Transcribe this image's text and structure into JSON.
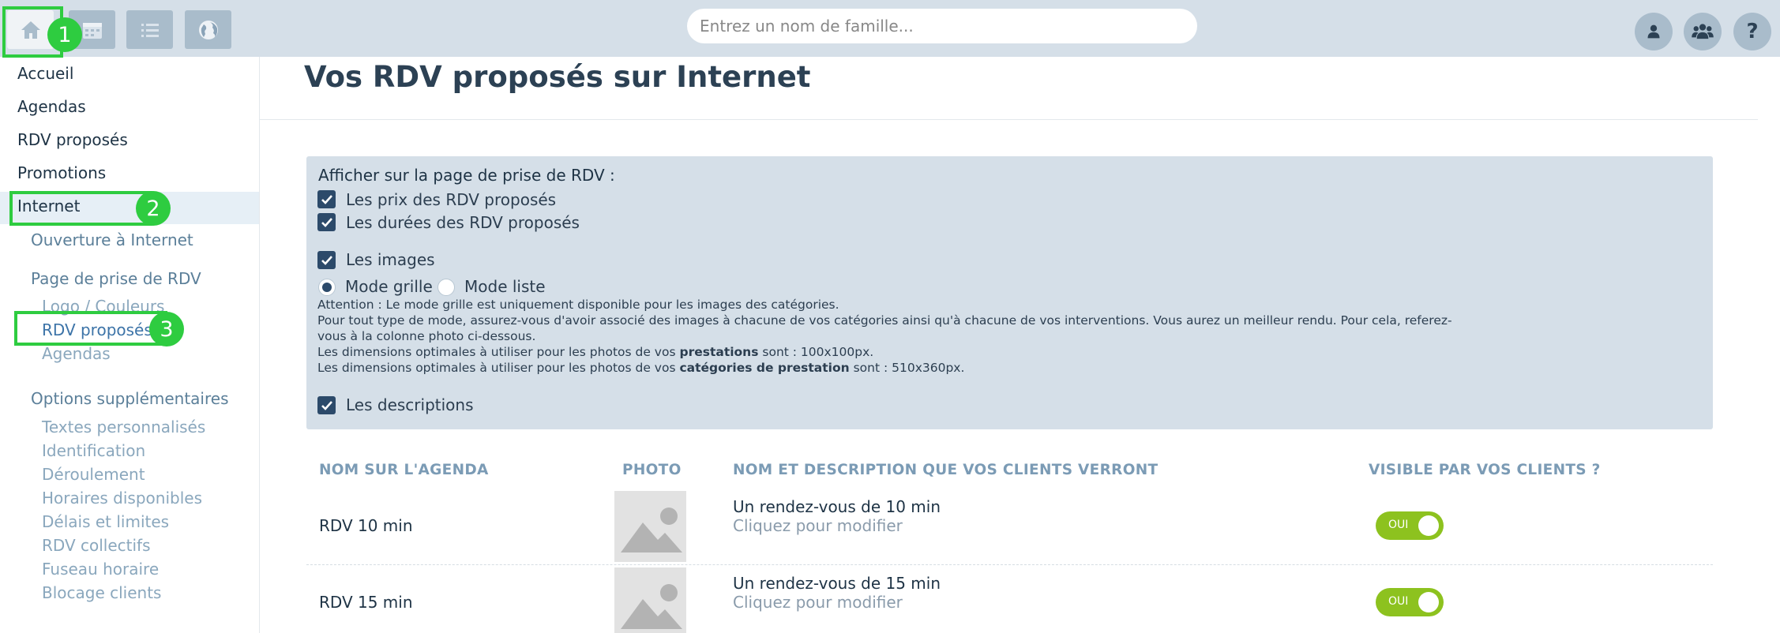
{
  "search": {
    "placeholder": "Entrez un nom de famille..."
  },
  "toolbar": {
    "help_label": "?"
  },
  "annotations": {
    "one": "1",
    "two": "2",
    "three": "3"
  },
  "sidebar": {
    "main_items": [
      "Accueil",
      "Agendas",
      "RDV proposés",
      "Promotions",
      "Internet"
    ],
    "internet_sub": {
      "ouverture": "Ouverture à Internet",
      "page_prise": "Page de prise de RDV",
      "page_items": [
        "Logo / Couleurs",
        "RDV proposés",
        "Agendas"
      ],
      "options": "Options supplémentaires",
      "option_items": [
        "Textes personnalisés",
        "Identification",
        "Déroulement",
        "Horaires disponibles",
        "Délais et limites",
        "RDV collectifs",
        "Fuseau horaire",
        "Blocage clients"
      ]
    }
  },
  "main": {
    "title": "Vos RDV proposés sur Internet",
    "panel": {
      "heading": "Afficher sur la page de prise de RDV :",
      "cb_prices": "Les prix des RDV proposés",
      "cb_durations": "Les durées des RDV proposés",
      "cb_images": "Les images",
      "mode_grid": "Mode grille",
      "mode_list": "Mode liste",
      "note1": "Attention : Le mode grille est uniquement disponible pour les images des catégories.",
      "note2": "Pour tout type de mode, assurez-vous d'avoir associé des images à chacune de vos catégories ainsi qu'à chacune de vos interventions. Vous aurez un meilleur rendu. Pour cela, referez-",
      "note3": "vous à la colonne photo ci-dessous.",
      "note4_a": "Les dimensions optimales à utiliser pour les photos de vos ",
      "note4_b": "prestations",
      "note4_c": " sont : 100x100px.",
      "note5_a": "Les dimensions optimales à utiliser pour les photos de vos ",
      "note5_b": "catégories de prestation",
      "note5_c": " sont : 510x360px.",
      "cb_descriptions": "Les descriptions"
    },
    "table": {
      "headers": [
        "NOM SUR L'AGENDA",
        "PHOTO",
        "NOM ET DESCRIPTION QUE VOS CLIENTS VERRONT",
        "VISIBLE PAR VOS CLIENTS ?"
      ],
      "rows": [
        {
          "name": "RDV 10 min",
          "title": "Un rendez-vous de 10 min",
          "subtitle": "Cliquez pour modifier",
          "visible": "OUI"
        },
        {
          "name": "RDV 15 min",
          "title": "Un rendez-vous de 15 min",
          "subtitle": "Cliquez pour modifier",
          "visible": "OUI"
        }
      ]
    }
  }
}
